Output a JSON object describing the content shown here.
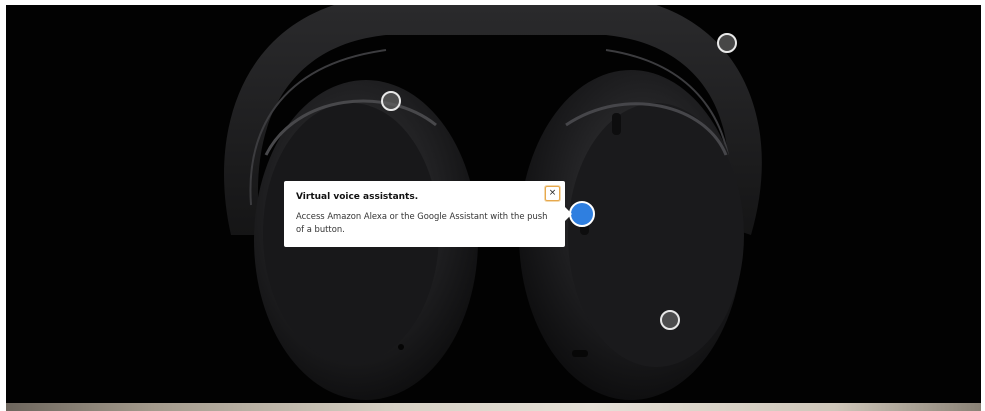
{
  "hero": {
    "product_image": "headphones-image"
  },
  "hotspots": [
    {
      "name": "hotspot-headband",
      "active": false
    },
    {
      "name": "hotspot-ear-cushion",
      "active": false
    },
    {
      "name": "hotspot-voice-assistant",
      "active": true
    },
    {
      "name": "hotspot-earcup-bottom",
      "active": false
    }
  ],
  "popover": {
    "title": "Virtual voice assistants.",
    "body": "Access Amazon Alexa or the Google Assistant with the push of a button.",
    "close_label": "×"
  },
  "colors": {
    "background": "#020202",
    "active_hotspot": "#2f7fe0",
    "close_focus_ring": "#e7a84c"
  }
}
